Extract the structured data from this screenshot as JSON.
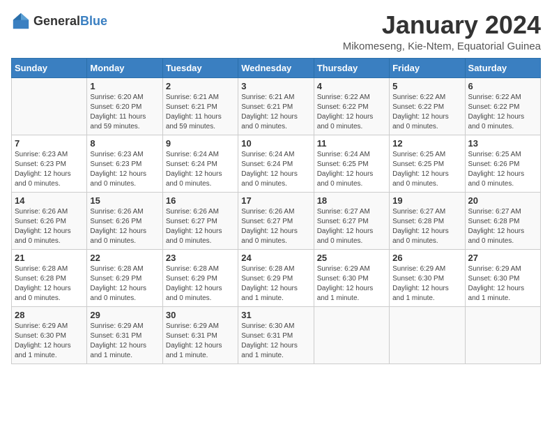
{
  "logo": {
    "text_general": "General",
    "text_blue": "Blue"
  },
  "calendar": {
    "title": "January 2024",
    "subtitle": "Mikomeseng, Kie-Ntem, Equatorial Guinea"
  },
  "weekdays": [
    "Sunday",
    "Monday",
    "Tuesday",
    "Wednesday",
    "Thursday",
    "Friday",
    "Saturday"
  ],
  "weeks": [
    [
      {
        "day": "",
        "info": ""
      },
      {
        "day": "1",
        "info": "Sunrise: 6:20 AM\nSunset: 6:20 PM\nDaylight: 11 hours\nand 59 minutes."
      },
      {
        "day": "2",
        "info": "Sunrise: 6:21 AM\nSunset: 6:21 PM\nDaylight: 11 hours\nand 59 minutes."
      },
      {
        "day": "3",
        "info": "Sunrise: 6:21 AM\nSunset: 6:21 PM\nDaylight: 12 hours\nand 0 minutes."
      },
      {
        "day": "4",
        "info": "Sunrise: 6:22 AM\nSunset: 6:22 PM\nDaylight: 12 hours\nand 0 minutes."
      },
      {
        "day": "5",
        "info": "Sunrise: 6:22 AM\nSunset: 6:22 PM\nDaylight: 12 hours\nand 0 minutes."
      },
      {
        "day": "6",
        "info": "Sunrise: 6:22 AM\nSunset: 6:22 PM\nDaylight: 12 hours\nand 0 minutes."
      }
    ],
    [
      {
        "day": "7",
        "info": "Sunrise: 6:23 AM\nSunset: 6:23 PM\nDaylight: 12 hours\nand 0 minutes."
      },
      {
        "day": "8",
        "info": "Sunrise: 6:23 AM\nSunset: 6:23 PM\nDaylight: 12 hours\nand 0 minutes."
      },
      {
        "day": "9",
        "info": "Sunrise: 6:24 AM\nSunset: 6:24 PM\nDaylight: 12 hours\nand 0 minutes."
      },
      {
        "day": "10",
        "info": "Sunrise: 6:24 AM\nSunset: 6:24 PM\nDaylight: 12 hours\nand 0 minutes."
      },
      {
        "day": "11",
        "info": "Sunrise: 6:24 AM\nSunset: 6:25 PM\nDaylight: 12 hours\nand 0 minutes."
      },
      {
        "day": "12",
        "info": "Sunrise: 6:25 AM\nSunset: 6:25 PM\nDaylight: 12 hours\nand 0 minutes."
      },
      {
        "day": "13",
        "info": "Sunrise: 6:25 AM\nSunset: 6:26 PM\nDaylight: 12 hours\nand 0 minutes."
      }
    ],
    [
      {
        "day": "14",
        "info": "Sunrise: 6:26 AM\nSunset: 6:26 PM\nDaylight: 12 hours\nand 0 minutes."
      },
      {
        "day": "15",
        "info": "Sunrise: 6:26 AM\nSunset: 6:26 PM\nDaylight: 12 hours\nand 0 minutes."
      },
      {
        "day": "16",
        "info": "Sunrise: 6:26 AM\nSunset: 6:27 PM\nDaylight: 12 hours\nand 0 minutes."
      },
      {
        "day": "17",
        "info": "Sunrise: 6:26 AM\nSunset: 6:27 PM\nDaylight: 12 hours\nand 0 minutes."
      },
      {
        "day": "18",
        "info": "Sunrise: 6:27 AM\nSunset: 6:27 PM\nDaylight: 12 hours\nand 0 minutes."
      },
      {
        "day": "19",
        "info": "Sunrise: 6:27 AM\nSunset: 6:28 PM\nDaylight: 12 hours\nand 0 minutes."
      },
      {
        "day": "20",
        "info": "Sunrise: 6:27 AM\nSunset: 6:28 PM\nDaylight: 12 hours\nand 0 minutes."
      }
    ],
    [
      {
        "day": "21",
        "info": "Sunrise: 6:28 AM\nSunset: 6:28 PM\nDaylight: 12 hours\nand 0 minutes."
      },
      {
        "day": "22",
        "info": "Sunrise: 6:28 AM\nSunset: 6:29 PM\nDaylight: 12 hours\nand 0 minutes."
      },
      {
        "day": "23",
        "info": "Sunrise: 6:28 AM\nSunset: 6:29 PM\nDaylight: 12 hours\nand 0 minutes."
      },
      {
        "day": "24",
        "info": "Sunrise: 6:28 AM\nSunset: 6:29 PM\nDaylight: 12 hours\nand 1 minute."
      },
      {
        "day": "25",
        "info": "Sunrise: 6:29 AM\nSunset: 6:30 PM\nDaylight: 12 hours\nand 1 minute."
      },
      {
        "day": "26",
        "info": "Sunrise: 6:29 AM\nSunset: 6:30 PM\nDaylight: 12 hours\nand 1 minute."
      },
      {
        "day": "27",
        "info": "Sunrise: 6:29 AM\nSunset: 6:30 PM\nDaylight: 12 hours\nand 1 minute."
      }
    ],
    [
      {
        "day": "28",
        "info": "Sunrise: 6:29 AM\nSunset: 6:30 PM\nDaylight: 12 hours\nand 1 minute."
      },
      {
        "day": "29",
        "info": "Sunrise: 6:29 AM\nSunset: 6:31 PM\nDaylight: 12 hours\nand 1 minute."
      },
      {
        "day": "30",
        "info": "Sunrise: 6:29 AM\nSunset: 6:31 PM\nDaylight: 12 hours\nand 1 minute."
      },
      {
        "day": "31",
        "info": "Sunrise: 6:30 AM\nSunset: 6:31 PM\nDaylight: 12 hours\nand 1 minute."
      },
      {
        "day": "",
        "info": ""
      },
      {
        "day": "",
        "info": ""
      },
      {
        "day": "",
        "info": ""
      }
    ]
  ]
}
